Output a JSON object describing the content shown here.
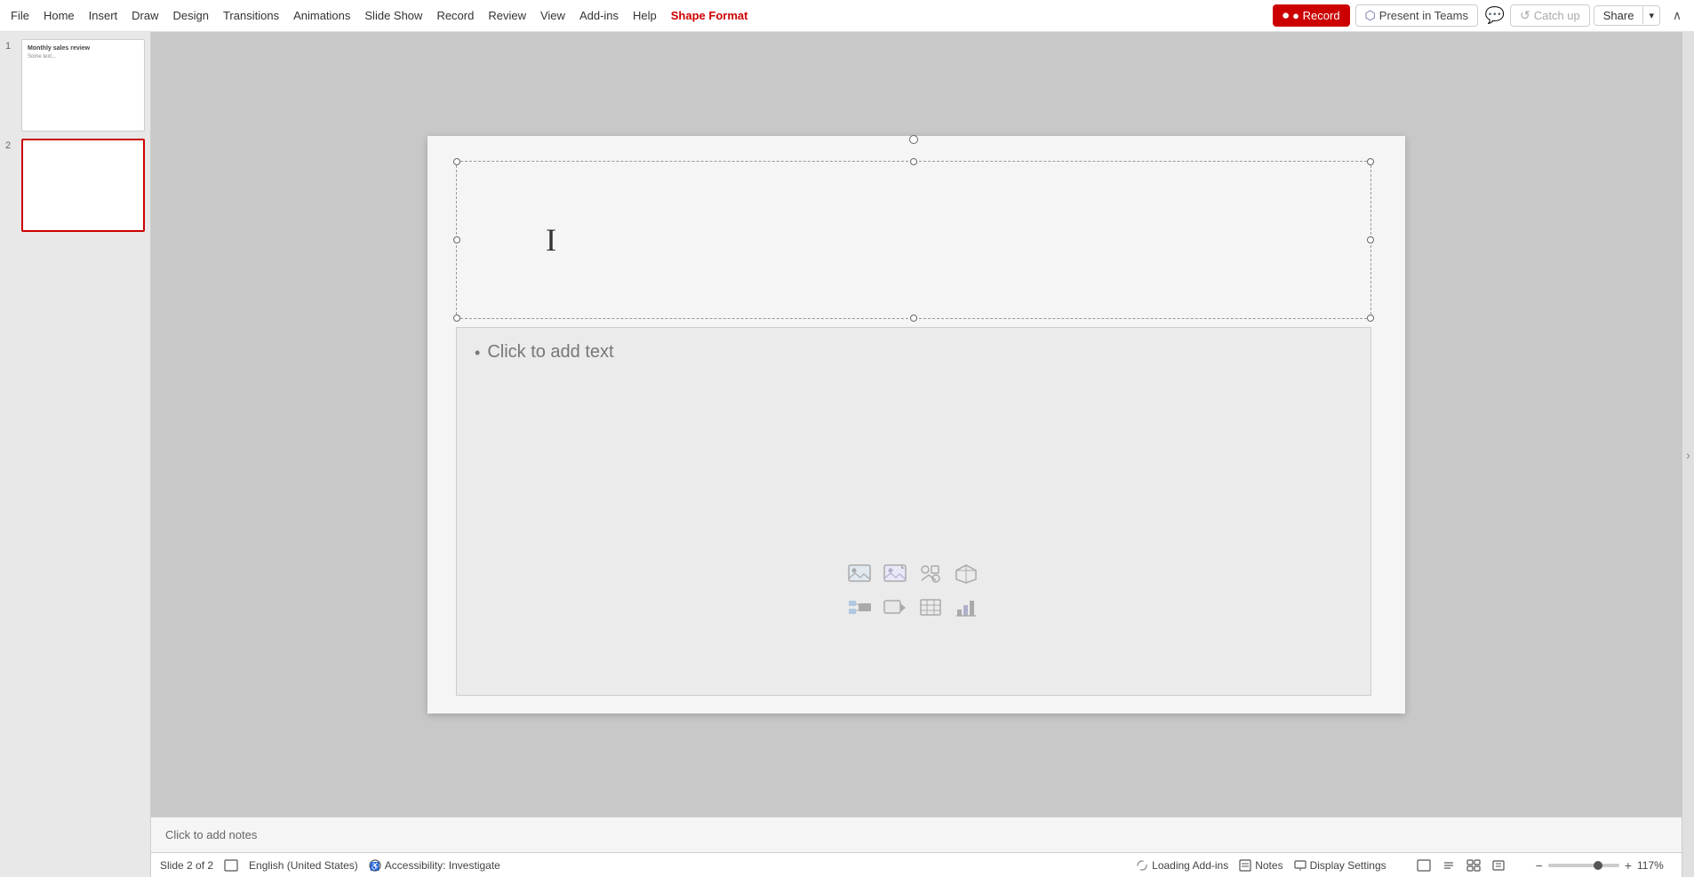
{
  "menubar": {
    "items": [
      {
        "label": "File",
        "id": "file"
      },
      {
        "label": "Home",
        "id": "home"
      },
      {
        "label": "Insert",
        "id": "insert"
      },
      {
        "label": "Draw",
        "id": "draw"
      },
      {
        "label": "Design",
        "id": "design"
      },
      {
        "label": "Transitions",
        "id": "transitions"
      },
      {
        "label": "Animations",
        "id": "animations"
      },
      {
        "label": "Slide Show",
        "id": "slideshow"
      },
      {
        "label": "Record",
        "id": "record"
      },
      {
        "label": "Review",
        "id": "review"
      },
      {
        "label": "View",
        "id": "view"
      },
      {
        "label": "Add-ins",
        "id": "addins"
      },
      {
        "label": "Help",
        "id": "help"
      },
      {
        "label": "Shape Format",
        "id": "shapeformat",
        "active": true
      }
    ],
    "record_btn": "● Record",
    "present_btn": "Present in Teams",
    "comments_btn": "💬",
    "catchup_btn": "Catch up",
    "share_btn": "Share"
  },
  "slides": [
    {
      "number": "1",
      "title": "Monthly sales review",
      "subtitle": "Some text...",
      "selected": false
    },
    {
      "number": "2",
      "title": "",
      "subtitle": "",
      "selected": true
    }
  ],
  "canvas": {
    "title_placeholder": "",
    "content_placeholder": "• Click to add text",
    "content_icons": [
      "🖼",
      "📷",
      "🎨",
      "📁",
      "📹",
      "🎬",
      "⬜",
      "📊"
    ]
  },
  "notes": {
    "placeholder": "Click to add notes",
    "label": "Notes"
  },
  "statusbar": {
    "slide_info": "Slide 2 of 2",
    "language": "English (United States)",
    "accessibility": "Accessibility: Investigate",
    "loading": "Loading Add-ins",
    "notes_label": "Notes",
    "display_settings": "Display Settings",
    "zoom": "117%",
    "view_icons": [
      "normal",
      "outline",
      "slidesorter",
      "reading",
      "presenter"
    ]
  }
}
